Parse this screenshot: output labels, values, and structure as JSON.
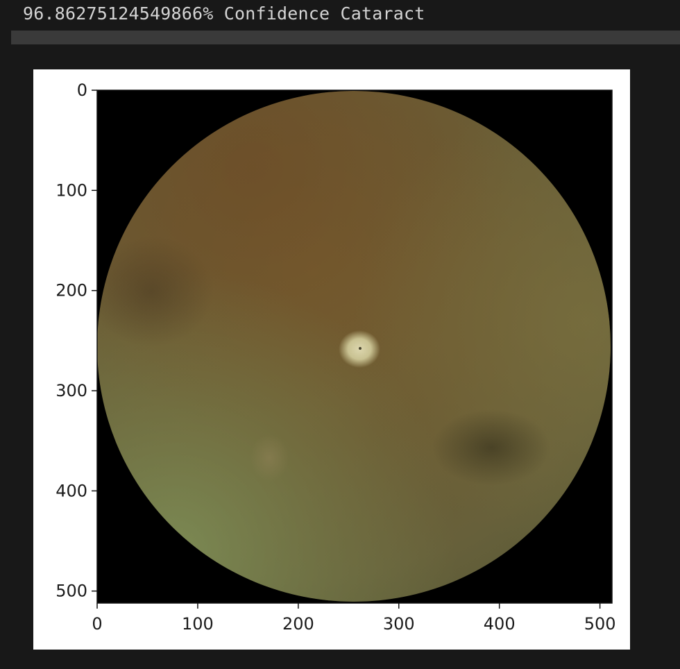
{
  "output": {
    "text": "96.86275124549866% Confidence Cataract"
  },
  "chart_data": {
    "type": "image",
    "image_description_free": true,
    "xlim": [
      0,
      512
    ],
    "ylim": [
      512,
      0
    ],
    "x_ticks": [
      0,
      100,
      200,
      300,
      400,
      500
    ],
    "y_ticks": [
      0,
      100,
      200,
      300,
      400,
      500
    ],
    "x_tick_labels": [
      "0",
      "100",
      "200",
      "300",
      "400",
      "500"
    ],
    "y_tick_labels": [
      "0",
      "100",
      "200",
      "300",
      "400",
      "500"
    ],
    "grid": false,
    "colors": {
      "background": "#000000",
      "fundus_base": "#6b5a35",
      "fundus_edge_light": "#7a8650",
      "optic_disc": "#d8d2a8"
    }
  }
}
